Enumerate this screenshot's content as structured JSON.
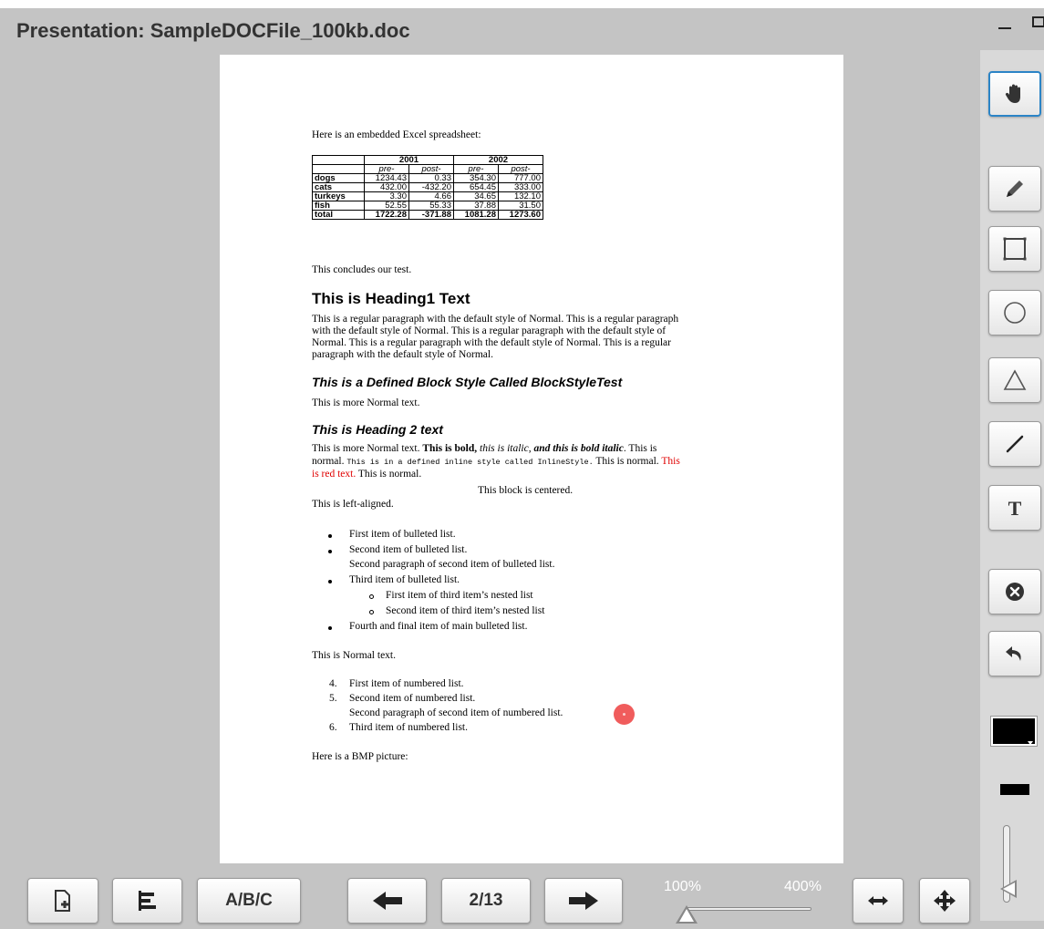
{
  "window": {
    "title": "Presentation: SampleDOCFile_100kb.doc"
  },
  "document": {
    "intro": "Here is an embedded Excel spreadsheet:",
    "table": {
      "years": [
        "2001",
        "2002"
      ],
      "subheaders": [
        "pre-",
        "post-",
        "pre-",
        "post-"
      ],
      "rows": [
        {
          "label": "dogs",
          "values": [
            "1234.43",
            "0.33",
            "354.30",
            "777.00"
          ]
        },
        {
          "label": "cats",
          "values": [
            "432.00",
            "-432.20",
            "654.45",
            "333.00"
          ]
        },
        {
          "label": "turkeys",
          "values": [
            "3.30",
            "4.66",
            "34.65",
            "132.10"
          ]
        },
        {
          "label": "fish",
          "values": [
            "52.55",
            "55.33",
            "37.88",
            "31.50"
          ]
        },
        {
          "label": "total",
          "values": [
            "1722.28",
            "-371.88",
            "1081.28",
            "1273.60"
          ]
        }
      ]
    },
    "conclude": "This concludes our test.",
    "heading1": "This is Heading1 Text",
    "paragraph_lines": [
      "This is a regular paragraph with the default style of Normal. This is a regular paragraph",
      "with the default style of Normal. This is a regular paragraph with the default style of",
      "Normal. This is a regular paragraph with the default style of Normal. This is a regular",
      "paragraph with the default style of Normal."
    ],
    "block_style": "This is a Defined Block Style Called BlockStyleTest",
    "more_normal": "This is more Normal text.",
    "heading2": "This is Heading 2 text",
    "mixed": {
      "normal1": "This is more Normal text. ",
      "bold": "This is bold, ",
      "italic": "this is italic",
      "comma": ", ",
      "bold_italic": "and this is bold italic",
      "normal2": ". This is",
      "normal3": "normal. ",
      "inline": "This is in a defined inline style called InlineStyle.",
      "normal4": " This is normal. ",
      "red1": "This",
      "red2": "is red text.",
      "normal5": " This is normal."
    },
    "centered": "This block is centered.",
    "left_aligned": "This is left-aligned.",
    "bullets": {
      "item1": "First item of bulleted list.",
      "item2": "Second item of bulleted list.",
      "item2_para": "Second paragraph of second item of bulleted list.",
      "item3": "Third item of bulleted list.",
      "nested1": "First item of third item’s nested list",
      "nested2": "Second item of third item’s nested list",
      "item4": "Fourth and final item of main bulleted list."
    },
    "normal_text": "This is Normal text.",
    "numbered": [
      {
        "num": "4.",
        "text": "First item of numbered list."
      },
      {
        "num": "5.",
        "text": "Second item of numbered list."
      },
      {
        "num": "",
        "text": "Second paragraph of second item of numbered list."
      },
      {
        "num": "6.",
        "text": "Third item of numbered list."
      }
    ],
    "bmp": "Here is a BMP picture:"
  },
  "toolbar": {
    "abc_label": "A/B/C",
    "page_indicator": "2/13",
    "zoom_min": "100%",
    "zoom_max": "400%",
    "zoom_level": 0
  },
  "tools": [
    "hand-icon",
    "pencil-icon",
    "rectangle-icon",
    "circle-icon",
    "triangle-icon",
    "line-icon",
    "text-icon",
    "clear-icon",
    "undo-icon"
  ],
  "colors": {
    "background": "#c4c4c4",
    "active_tool_border": "#2b84c6",
    "pen_color": "#000000",
    "red_text": "#e00000",
    "pointer": "#f05c5c"
  }
}
